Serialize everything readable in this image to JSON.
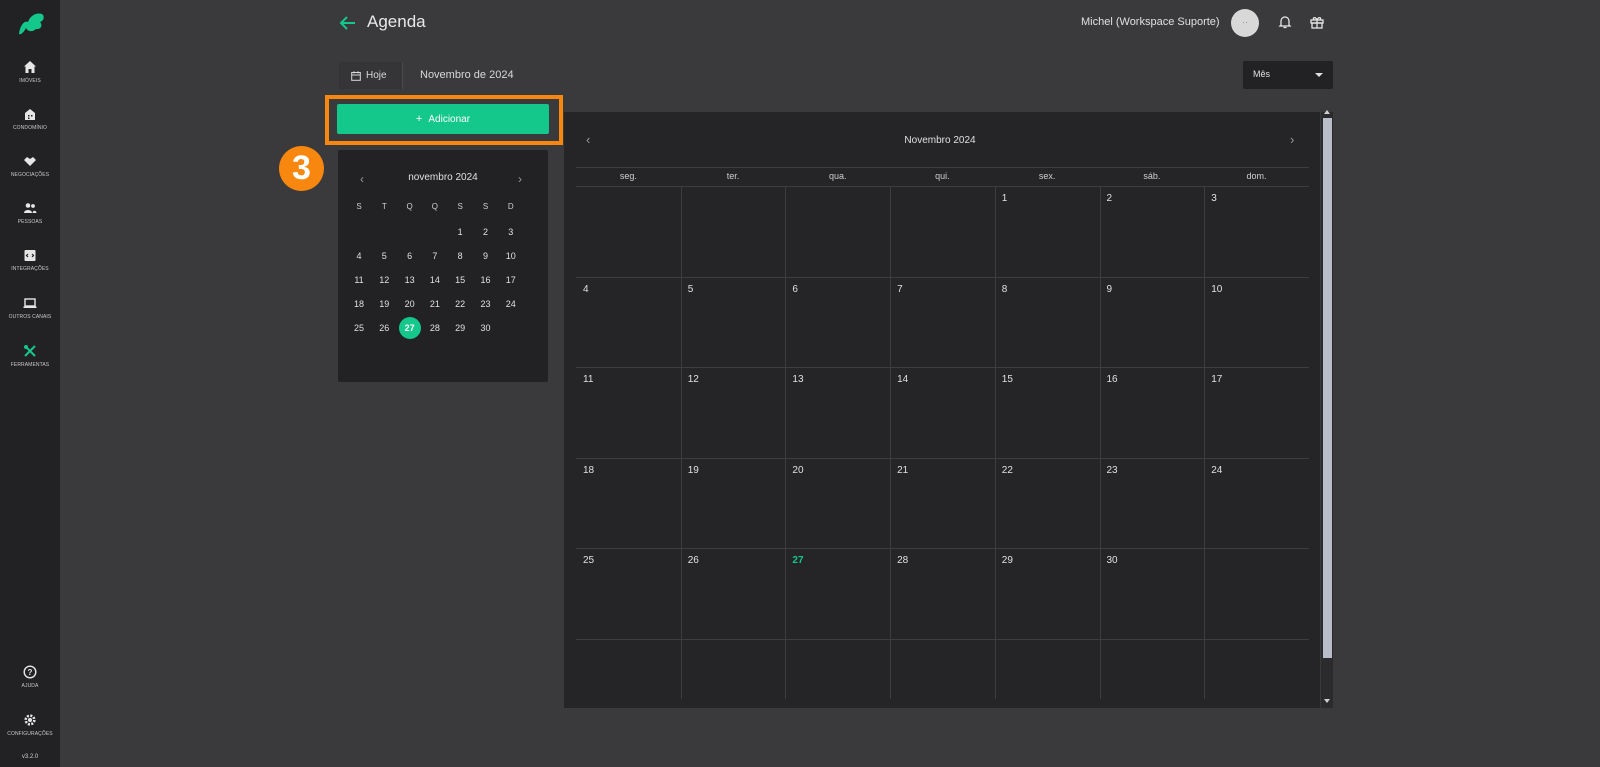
{
  "sidebar": {
    "items": [
      {
        "label": "IMÓVEIS",
        "icon": "home-icon"
      },
      {
        "label": "CONDOMÍNIO",
        "icon": "building-icon"
      },
      {
        "label": "NEGOCIAÇÕES",
        "icon": "handshake-icon"
      },
      {
        "label": "PESSOAS",
        "icon": "people-icon"
      },
      {
        "label": "INTEGRAÇÕES",
        "icon": "integration-icon"
      },
      {
        "label": "OUTROS CANAIS",
        "icon": "laptop-icon"
      },
      {
        "label": "FERRAMENTAS",
        "icon": "tools-icon"
      }
    ],
    "help_label": "AJUDA",
    "settings_label": "CONFIGURAÇÕES",
    "version": "v3.2.0"
  },
  "header": {
    "title": "Agenda",
    "user": "Michel (Workspace Suporte)",
    "avatar_text": "··"
  },
  "toolbar": {
    "today_label": "Hoje",
    "current_period": "Novembro de 2024",
    "view_selected": "Mês"
  },
  "add_button_label": "Adicionar",
  "step_badge": "3",
  "mini_calendar": {
    "title": "novembro 2024",
    "weekdays": [
      "S",
      "T",
      "Q",
      "Q",
      "S",
      "S",
      "D"
    ],
    "today": 27
  },
  "calendar": {
    "title": "Novembro 2024",
    "weekdays": [
      "seg.",
      "ter.",
      "qua.",
      "qui.",
      "sex.",
      "sáb.",
      "dom."
    ],
    "first_weekday_index": 4,
    "days_in_month": 30,
    "today": 27
  },
  "colors": {
    "accent": "#14c78a",
    "highlight": "#f7870f",
    "sidebar_bg": "#222225",
    "page_bg": "#3a3a3d"
  }
}
